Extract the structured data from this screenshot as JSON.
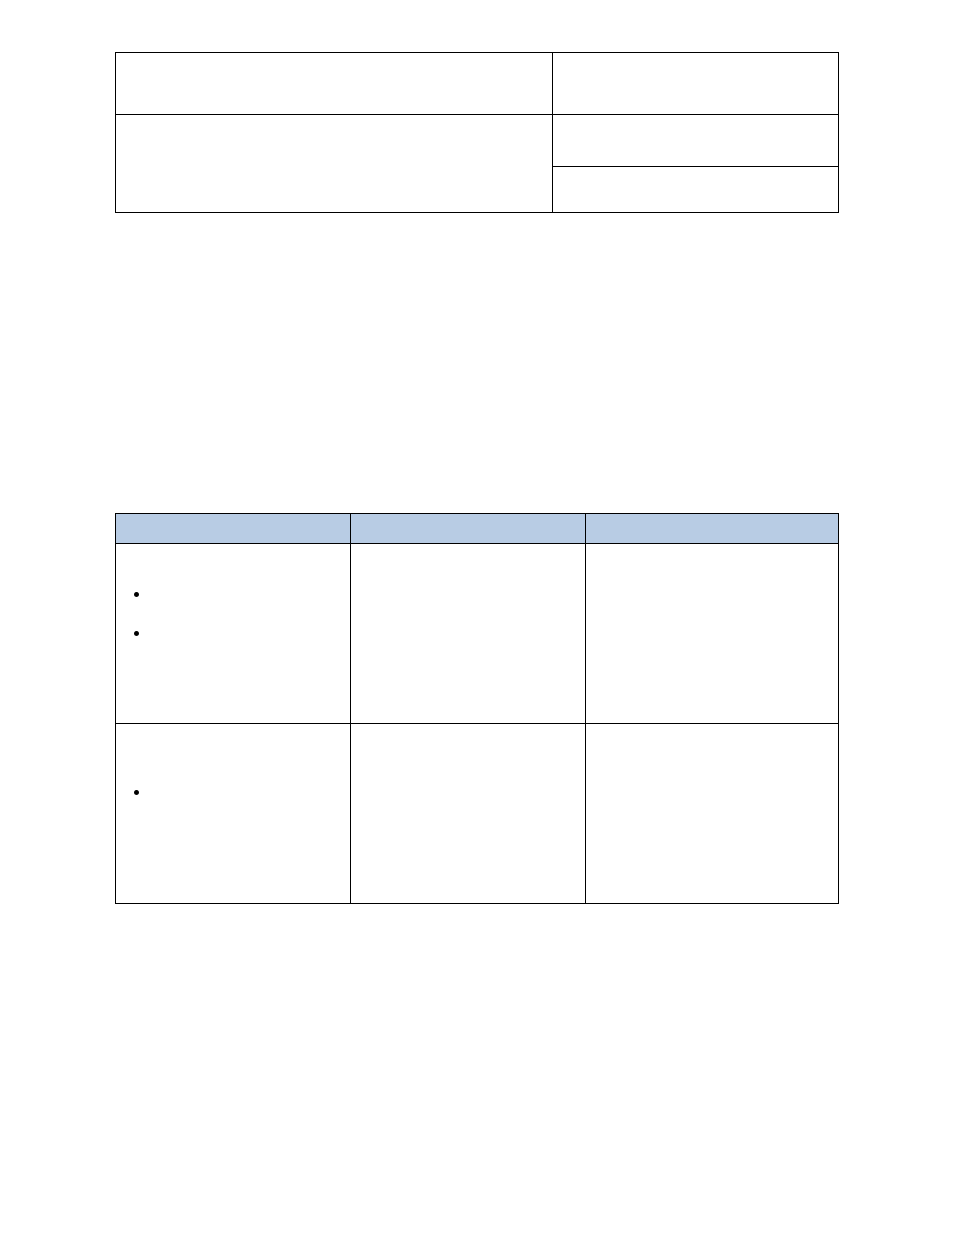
{
  "top_table": {
    "rows": [
      {
        "left": "",
        "right": ""
      },
      {
        "left": "",
        "right_top": "",
        "right_bottom": ""
      }
    ]
  },
  "bottom_table": {
    "headers": [
      "",
      "",
      ""
    ],
    "rows": [
      {
        "col1_bullets": [
          "",
          ""
        ],
        "col2": "",
        "col3": ""
      },
      {
        "col1_bullets": [
          ""
        ],
        "col2": "",
        "col3": ""
      }
    ]
  }
}
